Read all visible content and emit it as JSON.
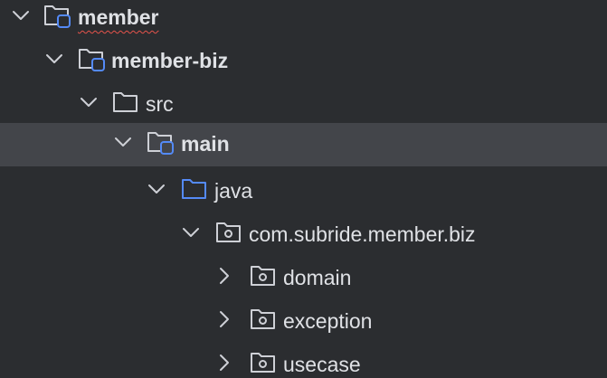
{
  "tree": {
    "nodes": [
      {
        "label": "member",
        "expanded": true,
        "module": true,
        "bold": true,
        "spellcheck_flag": true
      },
      {
        "label": "member-biz",
        "expanded": true,
        "module": true,
        "bold": true
      },
      {
        "label": "src",
        "expanded": true,
        "folder_type": "plain"
      },
      {
        "label": "main",
        "expanded": true,
        "module": true,
        "bold": true,
        "selected": true
      },
      {
        "label": "java",
        "expanded": true,
        "folder_type": "source-root"
      },
      {
        "label": "com.subride.member.biz",
        "expanded": true,
        "folder_type": "package"
      },
      {
        "label": "domain",
        "expanded": false,
        "folder_type": "package"
      },
      {
        "label": "exception",
        "expanded": false,
        "folder_type": "package"
      },
      {
        "label": "usecase",
        "expanded": false,
        "folder_type": "package"
      }
    ]
  },
  "colors": {
    "background": "#2b2d30",
    "selected_row": "#43454a",
    "text": "#dfe1e5",
    "icon_gray": "#ced0d6",
    "source_root_blue": "#548af7",
    "module_badge_blue": "#548af7",
    "spellcheck_red": "#e5534b"
  }
}
